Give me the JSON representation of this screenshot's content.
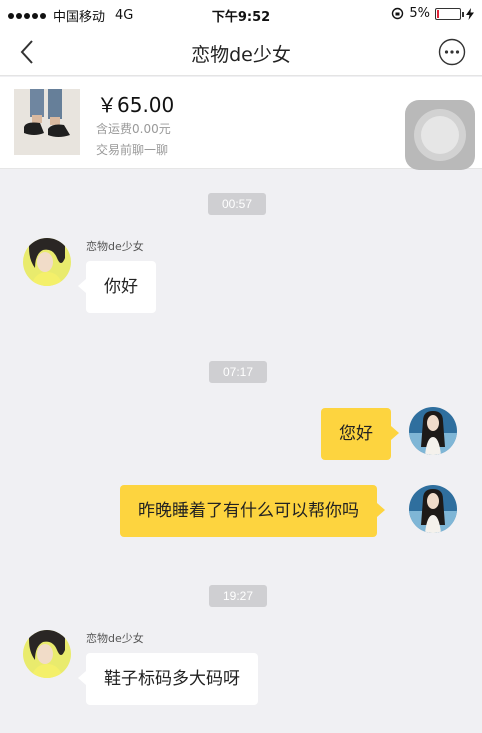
{
  "status_bar": {
    "carrier": "中国移动",
    "network": "4G",
    "time": "下午9:52",
    "battery": "5%",
    "battery_level": 0.05
  },
  "nav": {
    "title": "恋物de少女",
    "back_icon": "chevron-left-icon",
    "more_icon": "more-icon"
  },
  "product": {
    "price": "￥65.00",
    "shipping": "含运费0.00元",
    "tip": "交易前聊一聊"
  },
  "messages": {
    "ts1": "00:57",
    "m1_sender": "恋物de少女",
    "m1_text": "你好",
    "ts2": "07:17",
    "m2_text": "您好",
    "m3_text": "昨晚睡着了有什么可以帮你吗",
    "ts3": "19:27",
    "m4_sender": "恋物de少女",
    "m4_text": "鞋子标码多大码呀"
  },
  "colors": {
    "outgoing_bubble": "#fdd43f",
    "incoming_bubble": "#ffffff",
    "background": "#f0f0f3"
  }
}
